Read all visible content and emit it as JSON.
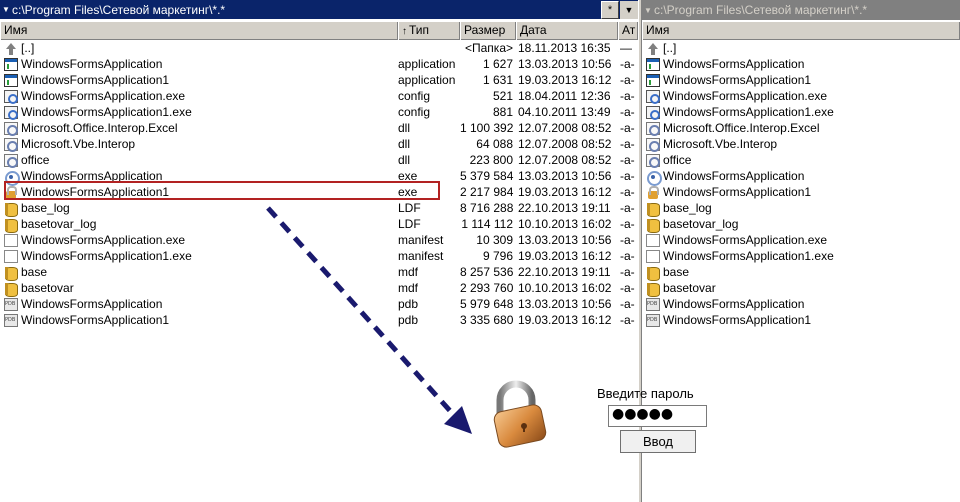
{
  "left_panel": {
    "path": "c:\\Program Files\\Сетевой маркетинг\\*.*",
    "path_btn_star": "*",
    "path_btn_dropdown": "▼",
    "columns": {
      "name": "Имя",
      "type": "Тип",
      "size": "Размер",
      "date": "Дата",
      "attr": "Ат"
    },
    "sort_arrow": "↑",
    "rows": [
      {
        "name": "[..]",
        "type": "",
        "size": "<Папка>",
        "date": "18.11.2013 16:35",
        "attr": "—",
        "icon": "up-dir-icon"
      },
      {
        "name": "WindowsFormsApplication",
        "type": "application",
        "size": "1 627",
        "date": "13.03.2013 10:56",
        "attr": "-a-",
        "icon": "application-icon"
      },
      {
        "name": "WindowsFormsApplication1",
        "type": "application",
        "size": "1 631",
        "date": "19.03.2013 16:12",
        "attr": "-a-",
        "icon": "application-icon"
      },
      {
        "name": "WindowsFormsApplication.exe",
        "type": "config",
        "size": "521",
        "date": "18.04.2011 12:36",
        "attr": "-a-",
        "icon": "config-icon"
      },
      {
        "name": "WindowsFormsApplication1.exe",
        "type": "config",
        "size": "881",
        "date": "04.10.2011 13:49",
        "attr": "-a-",
        "icon": "config-icon"
      },
      {
        "name": "Microsoft.Office.Interop.Excel",
        "type": "dll",
        "size": "1 100 392",
        "date": "12.07.2008 08:52",
        "attr": "-a-",
        "icon": "dll-icon"
      },
      {
        "name": "Microsoft.Vbe.Interop",
        "type": "dll",
        "size": "64 088",
        "date": "12.07.2008 08:52",
        "attr": "-a-",
        "icon": "dll-icon"
      },
      {
        "name": "office",
        "type": "dll",
        "size": "223 800",
        "date": "12.07.2008 08:52",
        "attr": "-a-",
        "icon": "dll-icon"
      },
      {
        "name": "WindowsFormsApplication",
        "type": "exe",
        "size": "5 379 584",
        "date": "13.03.2013 10:56",
        "attr": "-a-",
        "icon": "exe-icon"
      },
      {
        "name": "WindowsFormsApplication1",
        "type": "exe",
        "size": "2 217 984",
        "date": "19.03.2013 16:12",
        "attr": "-a-",
        "icon": "locked-exe-icon"
      },
      {
        "name": "base_log",
        "type": "LDF",
        "size": "8 716 288",
        "date": "22.10.2013 19:11",
        "attr": "-a-",
        "icon": "database-icon"
      },
      {
        "name": "basetovar_log",
        "type": "LDF",
        "size": "1 114 112",
        "date": "10.10.2013 16:02",
        "attr": "-a-",
        "icon": "database-icon"
      },
      {
        "name": "WindowsFormsApplication.exe",
        "type": "manifest",
        "size": "10 309",
        "date": "13.03.2013 10:56",
        "attr": "-a-",
        "icon": "document-icon"
      },
      {
        "name": "WindowsFormsApplication1.exe",
        "type": "manifest",
        "size": "9 796",
        "date": "19.03.2013 16:12",
        "attr": "-a-",
        "icon": "document-icon"
      },
      {
        "name": "base",
        "type": "mdf",
        "size": "8 257 536",
        "date": "22.10.2013 19:11",
        "attr": "-a-",
        "icon": "database-icon"
      },
      {
        "name": "basetovar",
        "type": "mdf",
        "size": "2 293 760",
        "date": "10.10.2013 16:02",
        "attr": "-a-",
        "icon": "database-icon"
      },
      {
        "name": "WindowsFormsApplication",
        "type": "pdb",
        "size": "5 979 648",
        "date": "13.03.2013 10:56",
        "attr": "-a-",
        "icon": "pdb-icon"
      },
      {
        "name": "WindowsFormsApplication1",
        "type": "pdb",
        "size": "3 335 680",
        "date": "19.03.2013 16:12",
        "attr": "-a-",
        "icon": "pdb-icon"
      }
    ]
  },
  "right_panel": {
    "path": "c:\\Program Files\\Сетевой маркетинг\\*.*",
    "columns": {
      "name": "Имя"
    },
    "rows": [
      {
        "name": "[..]",
        "icon": "up-dir-icon"
      },
      {
        "name": "WindowsFormsApplication",
        "icon": "application-icon"
      },
      {
        "name": "WindowsFormsApplication1",
        "icon": "application-icon"
      },
      {
        "name": "WindowsFormsApplication.exe",
        "icon": "config-icon"
      },
      {
        "name": "WindowsFormsApplication1.exe",
        "icon": "config-icon"
      },
      {
        "name": "Microsoft.Office.Interop.Excel",
        "icon": "dll-icon"
      },
      {
        "name": "Microsoft.Vbe.Interop",
        "icon": "dll-icon"
      },
      {
        "name": "office",
        "icon": "dll-icon"
      },
      {
        "name": "WindowsFormsApplication",
        "icon": "exe-icon"
      },
      {
        "name": "WindowsFormsApplication1",
        "icon": "locked-exe-icon"
      },
      {
        "name": "base_log",
        "icon": "database-icon"
      },
      {
        "name": "basetovar_log",
        "icon": "database-icon"
      },
      {
        "name": "WindowsFormsApplication.exe",
        "icon": "document-icon"
      },
      {
        "name": "WindowsFormsApplication1.exe",
        "icon": "document-icon"
      },
      {
        "name": "base",
        "icon": "database-icon"
      },
      {
        "name": "basetovar",
        "icon": "database-icon"
      },
      {
        "name": "WindowsFormsApplication",
        "icon": "pdb-icon"
      },
      {
        "name": "WindowsFormsApplication1",
        "icon": "pdb-icon"
      }
    ]
  },
  "password_dialog": {
    "label": "Введите пароль",
    "value": "●●●●●",
    "button": "Ввод"
  },
  "colors": {
    "active_header": "#0a246a",
    "inactive_header": "#808080",
    "highlight_border": "#b22222",
    "arrow": "#1a1a6e"
  }
}
